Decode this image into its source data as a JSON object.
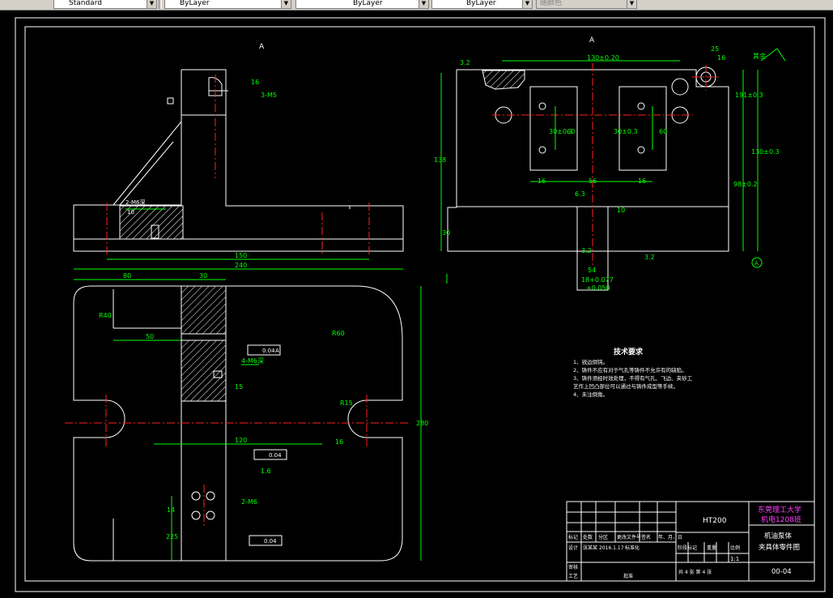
{
  "toolbar": {
    "text_style": "Standard",
    "layer": "ByLayer",
    "linetype": "ByLayer",
    "lineweight": "ByLayer",
    "plot_style": "随颜色"
  },
  "drawing": {
    "section_label_left": "A",
    "section_label_right": "A",
    "dims": {
      "d_16_a": "16",
      "d_3m5": "3-M5",
      "d_2m6": "2-M6深",
      "d_10": "10",
      "d_150": "150",
      "d_240": "240",
      "d_80": "80",
      "d_30": "30",
      "d_50": "50",
      "d_r40": "R40",
      "d_r60": "R60",
      "d_4m6": "4-M6深",
      "d_15a": "15",
      "d_120": "120",
      "d_r15": "R15",
      "d_16b": "16",
      "d_280": "280",
      "d_004a": "0.04",
      "d_004b": "0.04",
      "d_004c": "0.04",
      "datum_a": "A",
      "d_16c": "1.6",
      "d_m6": "2-M6",
      "d_14": "14",
      "d_225": "225",
      "d_130": "130±0.20",
      "d_32": "3.2",
      "d_25": "25",
      "d_16d": "16",
      "d_32b": "3.2",
      "d_191": "191±0.3",
      "d_130b": "130±0.3",
      "d_98": "98±0.2",
      "d_30a": "30±0.3",
      "d_60a": "60",
      "d_30b": "30±0.3",
      "d_60b": "60",
      "d_15b": "15",
      "d_15c": "15",
      "d_16e": "16",
      "d_56": "56",
      "d_16f": "16",
      "d_63": "6.3",
      "d_138": "138",
      "d_30c": "30",
      "d_10b": "10",
      "d_32c": "3.2",
      "d_54": "54",
      "d_18": "18+0.077",
      "d_18b": "+0.050",
      "d_63b": "6.3",
      "d_32d": "3.2",
      "datum_a2": "A",
      "rough_label": "其余"
    },
    "notes": {
      "title": "技术要求",
      "lines": [
        "1、锐边倒钝。",
        "2、铸件不应有对于气孔等铸件不允许有的缺陷。",
        "3、铸件须经时效处理，不得有气孔、飞边、夹砂工",
        "艺作上凹凸部位可以通过与铸件成型等手续。",
        "4、未注倒角。"
      ]
    },
    "title_block": {
      "school": "东莞理工大学",
      "class": "机电1208班",
      "material": "HT200",
      "part_name_1": "机油泵体",
      "part_name_2": "夹具体零件图",
      "drawing_no": "00-04",
      "scale_label": "1:1",
      "row_labels": [
        "标记",
        "处数",
        "分区",
        "更改文件号",
        "签名",
        "年、月、日"
      ],
      "designer": "设计",
      "designer_name": "张某某",
      "date": "2016.1.17",
      "standard": "标准化",
      "stage": "阶段标记",
      "weight": "重量",
      "scale": "比例",
      "review": "审核",
      "process": "工艺",
      "approve": "批准",
      "sheets": "共 4 张  第 4 张"
    }
  }
}
